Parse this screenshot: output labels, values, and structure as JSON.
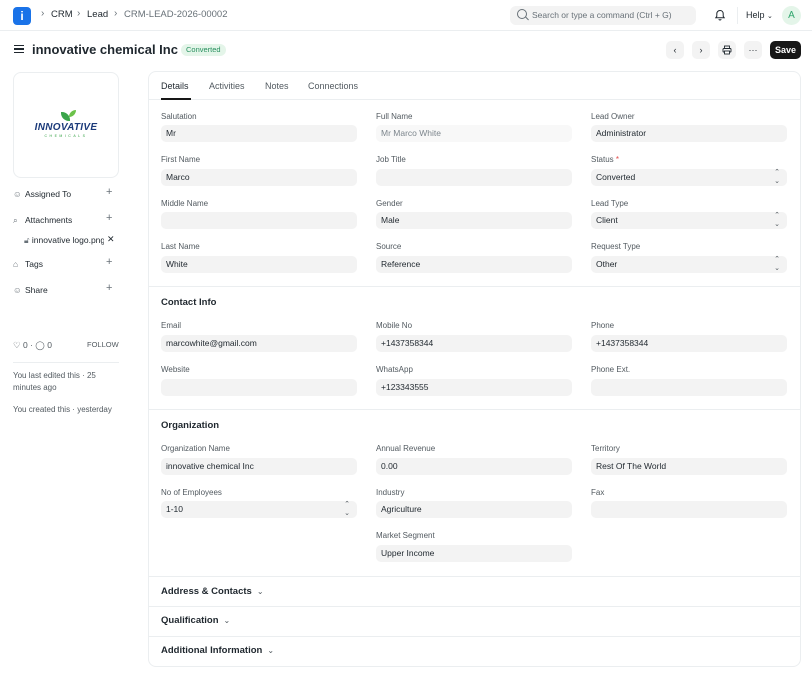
{
  "topbar": {
    "breadcrumbs": [
      "CRM",
      "Lead",
      "CRM-LEAD-2026-00002"
    ],
    "search_placeholder": "Search or type a command (Ctrl + G)",
    "help_label": "Help",
    "avatar_initial": "A"
  },
  "header": {
    "title": "innovative chemical Inc",
    "status_badge": "Converted",
    "save_label": "Save"
  },
  "sidebar": {
    "logo_text": "INNOVATIVE",
    "logo_sub": "CHEMICALS",
    "assigned_to": "Assigned To",
    "attachments": "Attachments",
    "attachment_file": "innovative logo.png",
    "tags": "Tags",
    "share": "Share",
    "likes": "0",
    "comments": "0",
    "follow": "FOLLOW",
    "last_edited": "You last edited this · 25 minutes ago",
    "created": "You created this · yesterday"
  },
  "tabs": [
    "Details",
    "Activities",
    "Notes",
    "Connections"
  ],
  "details": {
    "salutation_label": "Salutation",
    "salutation": "Mr",
    "full_name_label": "Full Name",
    "full_name": "Mr Marco White",
    "lead_owner_label": "Lead Owner",
    "lead_owner": "Administrator",
    "first_name_label": "First Name",
    "first_name": "Marco",
    "job_title_label": "Job Title",
    "job_title": "",
    "status_label": "Status",
    "status": "Converted",
    "middle_name_label": "Middle Name",
    "middle_name": "",
    "gender_label": "Gender",
    "gender": "Male",
    "lead_type_label": "Lead Type",
    "lead_type": "Client",
    "last_name_label": "Last Name",
    "last_name": "White",
    "source_label": "Source",
    "source": "Reference",
    "request_type_label": "Request Type",
    "request_type": "Other"
  },
  "contact": {
    "section_title": "Contact Info",
    "email_label": "Email",
    "email": "marcowhite@gmail.com",
    "mobile_label": "Mobile No",
    "mobile": "+1437358344",
    "phone_label": "Phone",
    "phone": "+1437358344",
    "website_label": "Website",
    "website": "",
    "whatsapp_label": "WhatsApp",
    "whatsapp": "+123343555",
    "phone_ext_label": "Phone Ext.",
    "phone_ext": ""
  },
  "organization": {
    "section_title": "Organization",
    "org_name_label": "Organization Name",
    "org_name": "innovative chemical Inc",
    "annual_revenue_label": "Annual Revenue",
    "annual_revenue": "0.00",
    "territory_label": "Territory",
    "territory": "Rest Of The World",
    "employees_label": "No of Employees",
    "employees": "1-10",
    "industry_label": "Industry",
    "industry": "Agriculture",
    "fax_label": "Fax",
    "fax": "",
    "market_segment_label": "Market Segment",
    "market_segment": "Upper Income"
  },
  "collapsed_sections": [
    "Address & Contacts",
    "Qualification",
    "Additional Information"
  ]
}
